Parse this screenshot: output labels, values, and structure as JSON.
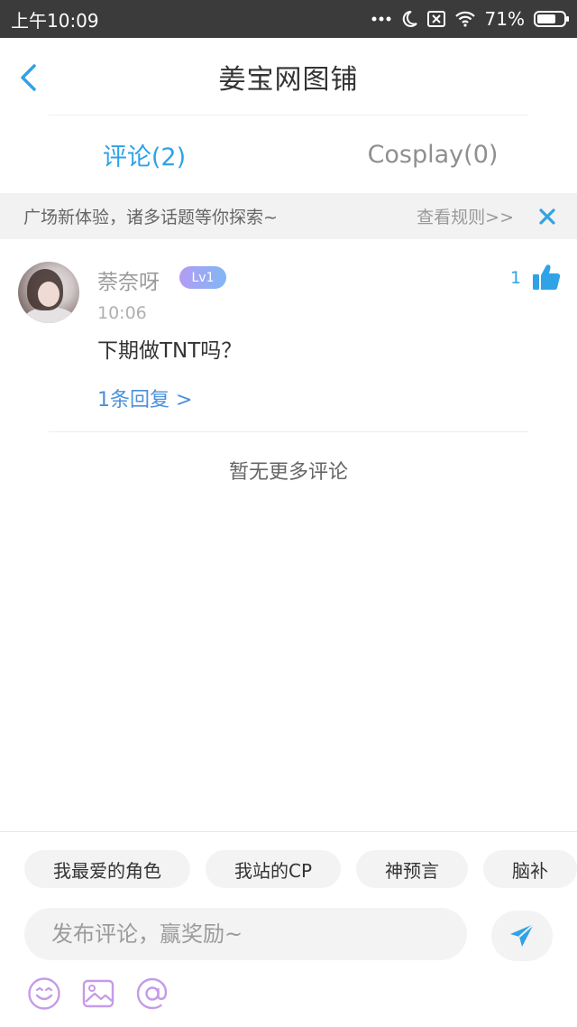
{
  "status_bar": {
    "time": "上午10:09",
    "battery_text": "71%",
    "battery_level": 0.71,
    "icons": [
      "more-dots-icon",
      "moon-icon",
      "no-sim-icon",
      "wifi-icon",
      "battery-icon"
    ]
  },
  "header": {
    "title": "姜宝网图铺",
    "back_icon": "chevron-left-icon"
  },
  "tabs": [
    {
      "label": "评论(2)",
      "active": true
    },
    {
      "label": "Cosplay(0)",
      "active": false
    }
  ],
  "notice": {
    "text": "广场新体验，诸多话题等你探索~",
    "link": "查看规则>>",
    "close_icon": "close-icon"
  },
  "comments": [
    {
      "username": "萘奈呀",
      "level": "Lv1",
      "time": "10:06",
      "content": "下期做TNT吗？",
      "replies": "1条回复 >",
      "likes": "1"
    }
  ],
  "no_more_text": "暂无更多评论",
  "composer": {
    "chips": [
      "我最爱的角色",
      "我站的CP",
      "神预言",
      "脑补"
    ],
    "placeholder": "发布评论，赢奖励~",
    "send_icon": "send-icon",
    "tools": [
      "emoji-icon",
      "image-icon",
      "at-icon"
    ]
  },
  "colors": {
    "accent": "#2fa3e6",
    "status_bar": "#3b3b3b",
    "notice_bg": "#f2f2f2",
    "tool_icon": "#c59be8"
  }
}
